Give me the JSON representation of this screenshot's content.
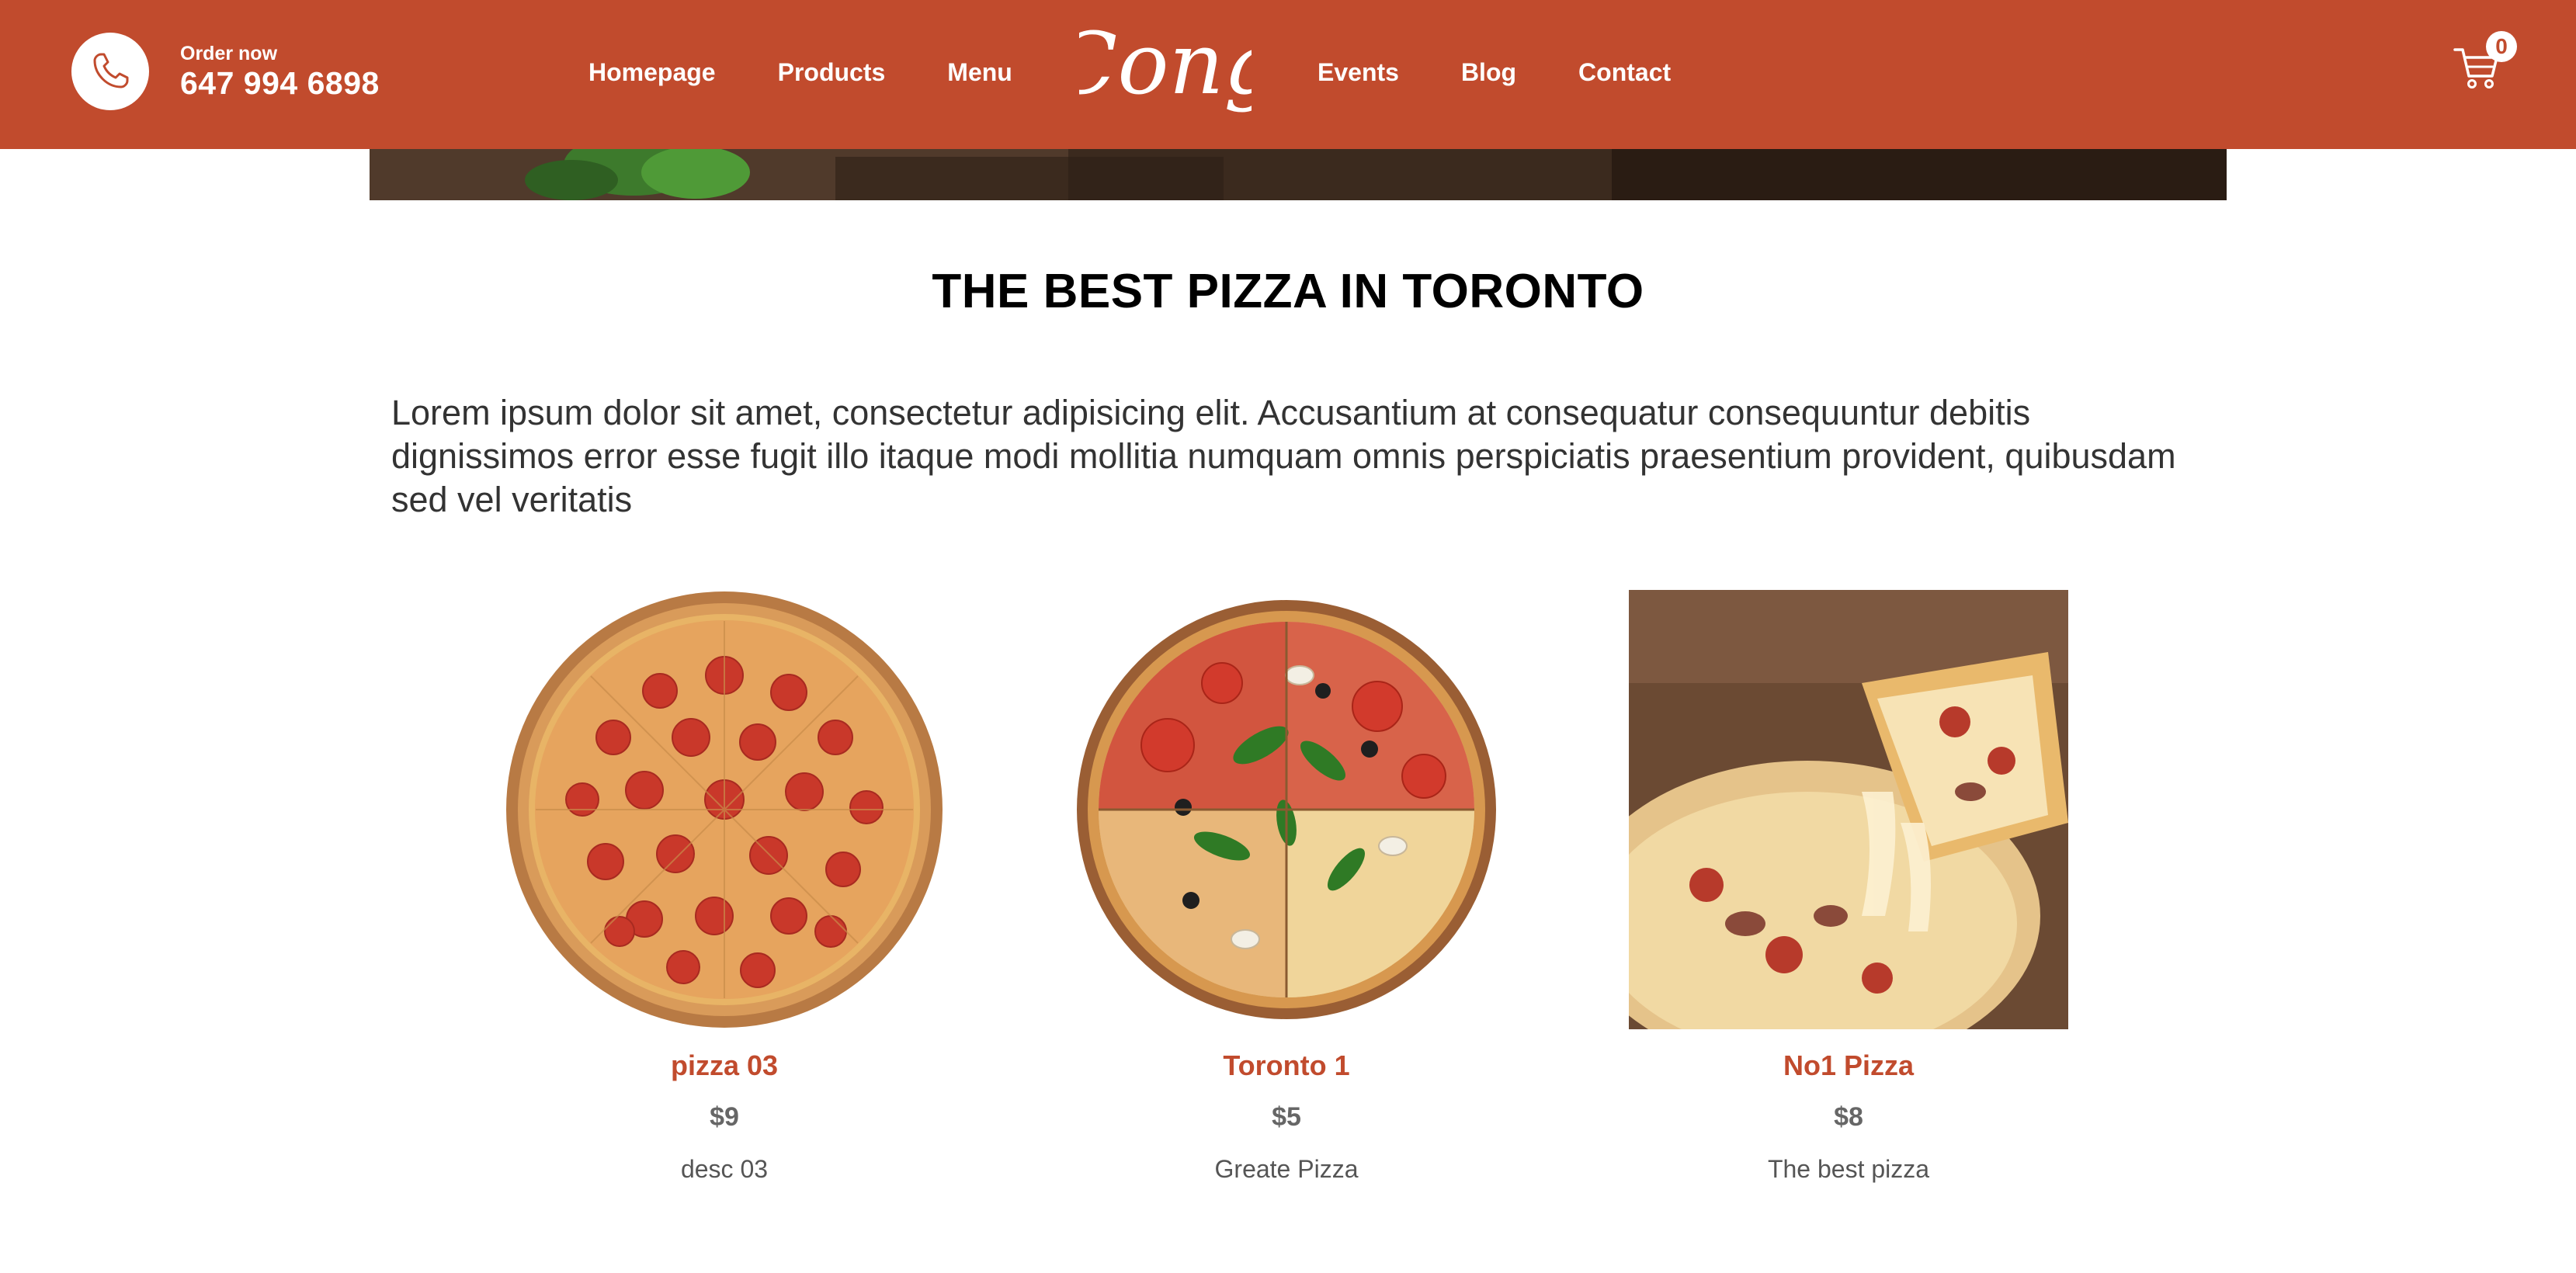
{
  "header": {
    "order_label": "Order now",
    "phone_number": "647 994 6898",
    "logo_text": "Cong",
    "nav_left": [
      "Homepage",
      "Products",
      "Menu"
    ],
    "nav_right": [
      "Events",
      "Blog",
      "Contact"
    ],
    "cart_count": "0",
    "background_color": "#c14b2d"
  },
  "main": {
    "title": "THE BEST PIZZA IN TORONTO",
    "description": "Lorem ipsum dolor sit amet, consectetur adipisicing elit. Accusantium at consequatur consequuntur debitis dignissimos error esse fugit illo itaque modi mollitia numquam omnis perspiciatis praesentium provident, quibusdam sed vel veritatis"
  },
  "products": [
    {
      "name": "pizza 03",
      "price": "$9",
      "desc": "desc 03",
      "image": "pepperoni-pizza"
    },
    {
      "name": "Toronto 1",
      "price": "$5",
      "desc": "Greate Pizza",
      "image": "veggie-pizza"
    },
    {
      "name": "No1 Pizza",
      "price": "$8",
      "desc": "The best pizza",
      "image": "cheese-pull-pizza"
    }
  ],
  "icons": {
    "phone": "phone-icon",
    "cart": "cart-icon"
  }
}
